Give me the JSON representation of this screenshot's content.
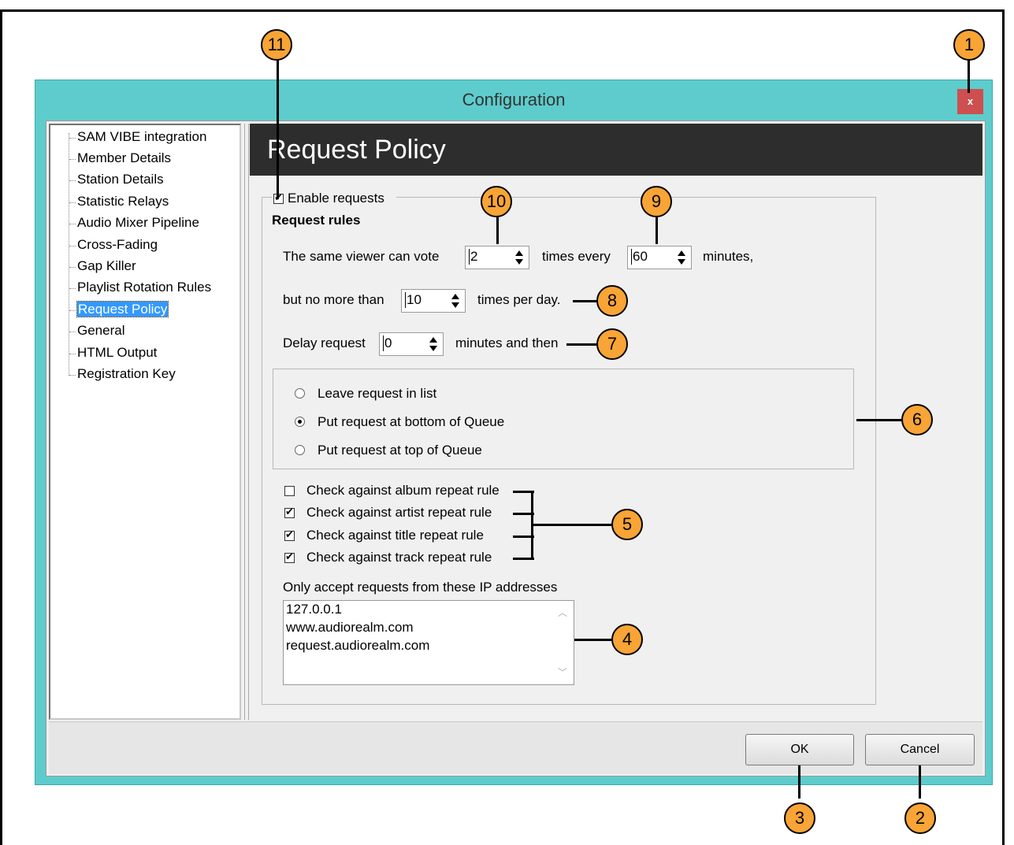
{
  "window": {
    "title": "Configuration",
    "close_label": "x"
  },
  "tree": {
    "items": [
      {
        "label": "SAM VIBE integration"
      },
      {
        "label": "Member Details"
      },
      {
        "label": "Station Details"
      },
      {
        "label": "Statistic Relays"
      },
      {
        "label": "Audio Mixer Pipeline"
      },
      {
        "label": "Cross-Fading"
      },
      {
        "label": "Gap Killer"
      },
      {
        "label": "Playlist Rotation Rules"
      },
      {
        "label": "Request Policy",
        "selected": true
      },
      {
        "label": "General"
      },
      {
        "label": "HTML Output"
      },
      {
        "label": "Registration Key"
      }
    ]
  },
  "panel": {
    "heading": "Request Policy",
    "enable_requests": {
      "label": "Enable requests",
      "checked": true
    },
    "rules_title": "Request rules",
    "vote_prefix": "The same viewer can vote",
    "vote_count": "2",
    "vote_middle": "times every",
    "vote_minutes": "60",
    "vote_suffix": "minutes,",
    "limit_prefix": "but no more than",
    "limit_count": "10",
    "limit_suffix": "times per day.",
    "delay_prefix": "Delay request",
    "delay_value": "0",
    "delay_suffix": "minutes and then",
    "placement_options": [
      {
        "label": "Leave request in list",
        "checked": false
      },
      {
        "label": "Put request at bottom of Queue",
        "checked": true
      },
      {
        "label": "Put request at top of Queue",
        "checked": false
      }
    ],
    "repeat_rules": [
      {
        "label": "Check against album repeat rule",
        "checked": false
      },
      {
        "label": "Check against artist repeat rule",
        "checked": true
      },
      {
        "label": "Check against title repeat rule",
        "checked": true
      },
      {
        "label": "Check against track repeat rule",
        "checked": true
      }
    ],
    "ip_label": "Only accept requests from these IP addresses",
    "ip_lines": [
      "127.0.0.1",
      "www.audiorealm.com",
      "request.audiorealm.com"
    ]
  },
  "footer": {
    "ok_label": "OK",
    "cancel_label": "Cancel"
  },
  "callouts": [
    "1",
    "2",
    "3",
    "4",
    "5",
    "6",
    "7",
    "8",
    "9",
    "10",
    "11"
  ],
  "colors": {
    "dialog_border": "#5ecccc",
    "close_button": "#cd4f4f",
    "header_bar": "#2d2d2d",
    "selection": "#3399ff",
    "callout": "#f8a436"
  }
}
